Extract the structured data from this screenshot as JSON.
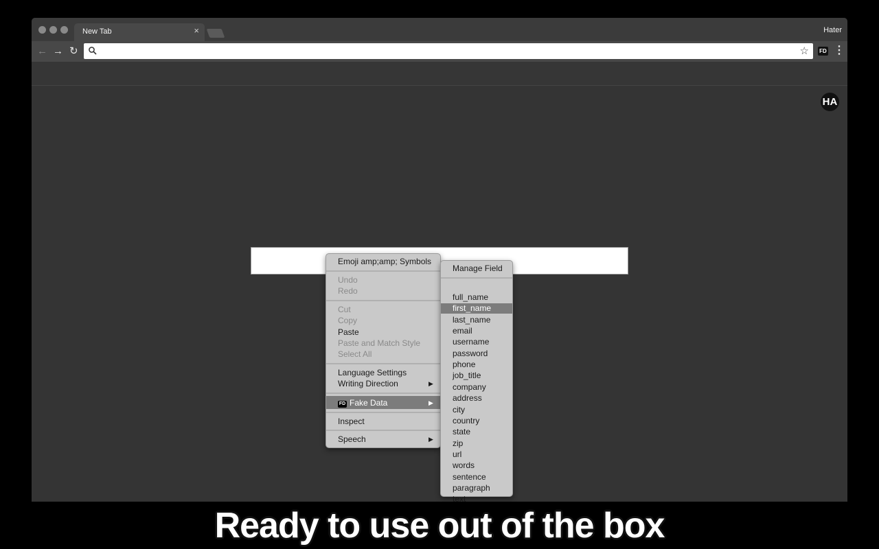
{
  "browser": {
    "tab_title": "New Tab",
    "tab_close": "×",
    "profile_name": "Hater",
    "omnibox_value": "",
    "extension_badge": "FD",
    "kebab": "⋮",
    "back": "←",
    "forward": "→",
    "reload": "↻",
    "star": "☆"
  },
  "page": {
    "avatar_text": "HA",
    "input_value": ""
  },
  "context_menu": {
    "emoji": "Emoji amp;amp; Symbols",
    "undo": "Undo",
    "redo": "Redo",
    "cut": "Cut",
    "copy": "Copy",
    "paste": "Paste",
    "paste_match": "Paste and Match Style",
    "select_all": "Select All",
    "language_settings": "Language Settings",
    "writing_direction": "Writing Direction",
    "fake_data": "Fake Data",
    "fake_data_badge": "FD",
    "inspect": "Inspect",
    "speech": "Speech"
  },
  "submenu": {
    "manage": "Manage Field",
    "items": [
      "full_name",
      "first_name",
      "last_name",
      "email",
      "username",
      "password",
      "phone",
      "job_title",
      "company",
      "address",
      "city",
      "country",
      "state",
      "zip",
      "url",
      "words",
      "sentence",
      "paragraph",
      "text"
    ],
    "selected": "first_name"
  },
  "caption": "Ready to use out of the box",
  "colors": {
    "menu_bg": "#c9c9c9",
    "highlight": "#7c7c7c",
    "content_bg": "#343434"
  }
}
